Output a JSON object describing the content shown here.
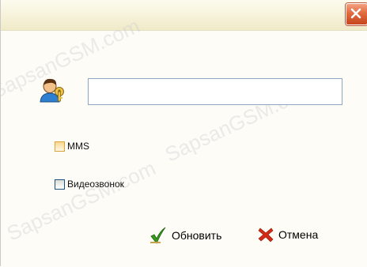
{
  "window": {
    "watermark": "SapsanGSM.com"
  },
  "form": {
    "name_value": "",
    "options": {
      "mms": {
        "label": "MMS",
        "checked": false
      },
      "video_call": {
        "label": "Видеозвонок",
        "checked": false
      }
    }
  },
  "buttons": {
    "update_label": "Обновить",
    "cancel_label": "Отмена"
  },
  "icons": {
    "close": "close-icon",
    "contact": "contact-icon",
    "update": "checkmark-icon",
    "cancel": "red-x-icon"
  },
  "colors": {
    "close_button": "#e06b3f",
    "checkmark": "#3a9a1e",
    "cancel_x": "#d42a16",
    "input_border": "#8ea5bd"
  }
}
